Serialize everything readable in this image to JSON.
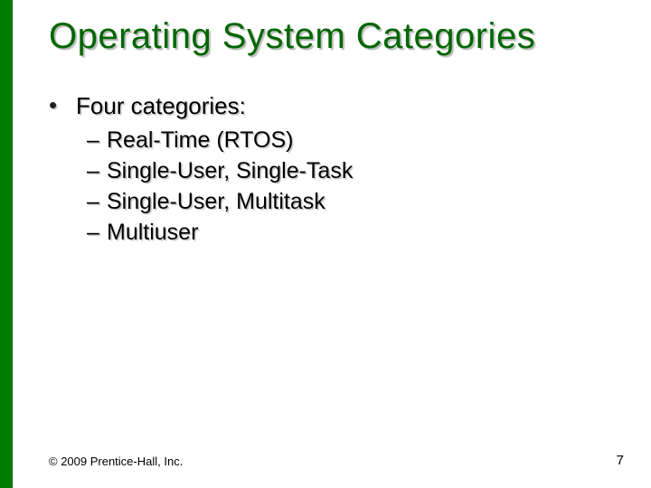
{
  "title": "Operating System Categories",
  "bullet_heading": "Four categories:",
  "subitems": [
    "Real-Time (RTOS)",
    "Single-User, Single-Task",
    "Single-User, Multitask",
    "Multiuser"
  ],
  "footer": {
    "copyright": "© 2009 Prentice-Hall, Inc.",
    "page_number": "7"
  },
  "accent_color": "#006600"
}
